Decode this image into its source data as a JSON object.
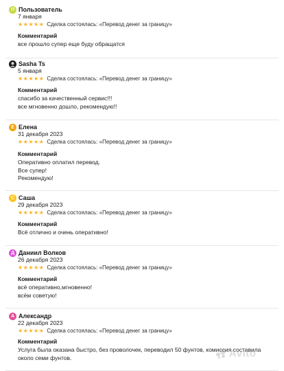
{
  "rating_stars": 5,
  "star_color": "#ffb021",
  "reviews": [
    {
      "name": "Пользователь",
      "avatar_letter": "П",
      "avatar_color": "#c6d93f",
      "avatar_text_color": "#ffffff",
      "date": "7 января",
      "deal": "Сделка состоялась: «Перевод денег за границу»",
      "comment_label": "Комментарий",
      "comment_lines": [
        "все прошло супер еще буду обращатся"
      ]
    },
    {
      "name": "Sasha Ts",
      "avatar_letter": "",
      "avatar_color": "#1f1f1f",
      "avatar_text_color": "#ffffff",
      "date": "5 января",
      "deal": "Сделка состоялась: «Перевод денег за границу»",
      "comment_label": "Комментарий",
      "comment_lines": [
        "спасибо за качественный сервис!!!",
        "все мгновенно дошло, рекомендую!!"
      ]
    },
    {
      "name": "Елена",
      "avatar_letter": "Е",
      "avatar_color": "#f3a40f",
      "avatar_text_color": "#ffffff",
      "date": "31 декабря 2023",
      "deal": "Сделка состоялась: «Перевод денег за границу»",
      "comment_label": "Комментарий",
      "comment_lines": [
        "Оперативно оплатил перевод.",
        "Все супер!",
        "Рекомендую!"
      ]
    },
    {
      "name": "Саша",
      "avatar_letter": "С",
      "avatar_color": "#ffc21d",
      "avatar_text_color": "#ffffff",
      "date": "29 декабря 2023",
      "deal": "Сделка состоялась: «Перевод денег за границу»",
      "comment_label": "Комментарий",
      "comment_lines": [
        "Всё отлично и очень оперативно!"
      ]
    },
    {
      "name": "Даниил Волков",
      "avatar_letter": "Д",
      "avatar_color": "#d94fd6",
      "avatar_text_color": "#ffffff",
      "date": "26 декабря 2023",
      "deal": "Сделка состоялась: «Перевод денег за границу»",
      "comment_label": "Комментарий",
      "comment_lines": [
        "всё оперативно,мгновенно!",
        "всём советую!"
      ]
    },
    {
      "name": "Александр",
      "avatar_letter": "А",
      "avatar_color": "#e34f9a",
      "avatar_text_color": "#ffffff",
      "date": "22 декабря 2023",
      "deal": "Сделка состоялась: «Перевод денег за границу»",
      "comment_label": "Комментарий",
      "comment_lines": [
        "Услуга была оказана быстро, без проволочек, переводил 50 фунтов, комиссия составила",
        "около семи фунтов."
      ]
    }
  ],
  "watermark": "Avito"
}
